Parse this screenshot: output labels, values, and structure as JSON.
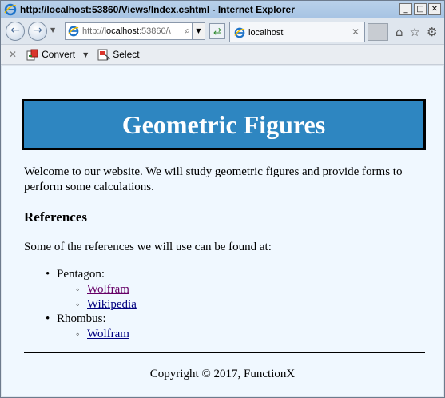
{
  "window": {
    "title": "http://localhost:53860/Views/Index.cshtml - Internet Explorer",
    "minimize": "_",
    "maximize": "□",
    "close": "✕"
  },
  "navbar": {
    "back_icon": "back-arrow-icon",
    "forward_icon": "forward-arrow-icon",
    "address_prefix": "http://",
    "address_host": "localhost",
    "address_rest": ":53860/\\",
    "tab_title": "localhost"
  },
  "commandbar": {
    "convert_label": "Convert",
    "select_label": "Select"
  },
  "page": {
    "heading": "Geometric Figures",
    "intro": "Welcome to our website. We will study geometric figures and provide forms to perform some calculations.",
    "references_heading": "References",
    "references_lead": "Some of the references we will use can be found at:",
    "items": [
      {
        "label": "Pentagon:",
        "links": [
          {
            "text": "Wolfram",
            "visited": true
          },
          {
            "text": "Wikipedia",
            "visited": false
          }
        ]
      },
      {
        "label": "Rhombus:",
        "links": [
          {
            "text": "Wolfram",
            "visited": false
          }
        ]
      }
    ],
    "footer": "Copyright © 2017, FunctionX"
  },
  "colors": {
    "banner_bg": "#2e86c1",
    "page_bg": "#f0f8ff",
    "link": "#000080",
    "visited_link": "#660066"
  }
}
